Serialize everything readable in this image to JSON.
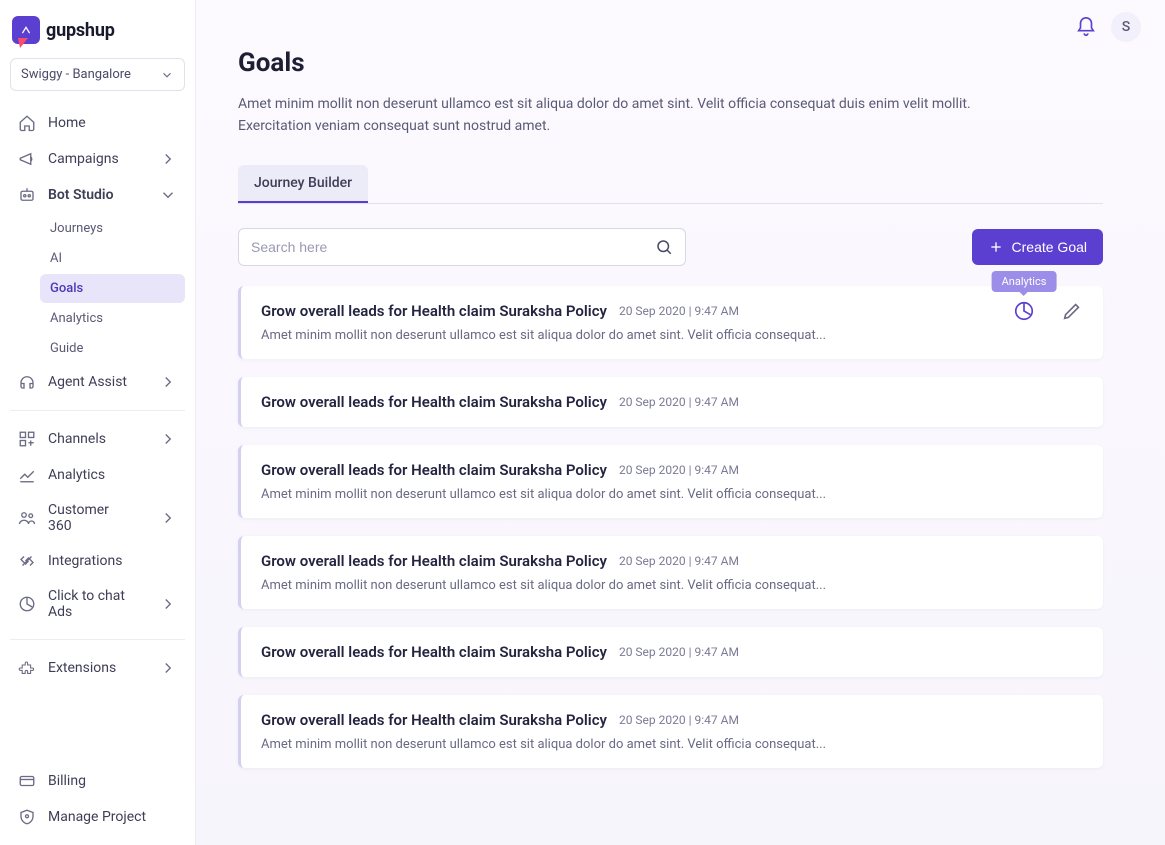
{
  "brand": "gupshup",
  "org_selector": {
    "label": "Swiggy - Bangalore"
  },
  "user_initial": "S",
  "nav": {
    "home": "Home",
    "campaigns": "Campaigns",
    "bot_studio": "Bot Studio",
    "bot_sub": {
      "journeys": "Journeys",
      "ai": "AI",
      "goals": "Goals",
      "analytics": "Analytics",
      "guide": "Guide"
    },
    "agent_assist": "Agent Assist",
    "channels": "Channels",
    "analytics": "Analytics",
    "customer360": "Customer 360",
    "integrations": "Integrations",
    "click_to_chat": "Click to chat Ads",
    "extensions": "Extensions",
    "billing": "Billing",
    "manage_project": "Manage Project"
  },
  "page": {
    "title": "Goals",
    "description": "Amet minim mollit non deserunt ullamco est sit aliqua dolor do amet sint. Velit officia consequat duis enim velit mollit. Exercitation veniam consequat sunt nostrud amet."
  },
  "tabs": {
    "journey_builder": "Journey Builder"
  },
  "search": {
    "placeholder": "Search here"
  },
  "create_button": "Create Goal",
  "tooltip_analytics": "Analytics",
  "goal_default": {
    "title": "Grow overall leads for Health claim Suraksha Policy",
    "meta": "20 Sep 2020  | 9:47 AM",
    "desc": "Amet minim mollit non deserunt ullamco est sit aliqua dolor do amet sint. Velit officia consequat..."
  },
  "goals": [
    {
      "showDesc": true,
      "showActions": true
    },
    {
      "showDesc": false,
      "showActions": false
    },
    {
      "showDesc": true,
      "showActions": false
    },
    {
      "showDesc": true,
      "showActions": false
    },
    {
      "showDesc": false,
      "showActions": false
    },
    {
      "showDesc": true,
      "showActions": false
    }
  ]
}
